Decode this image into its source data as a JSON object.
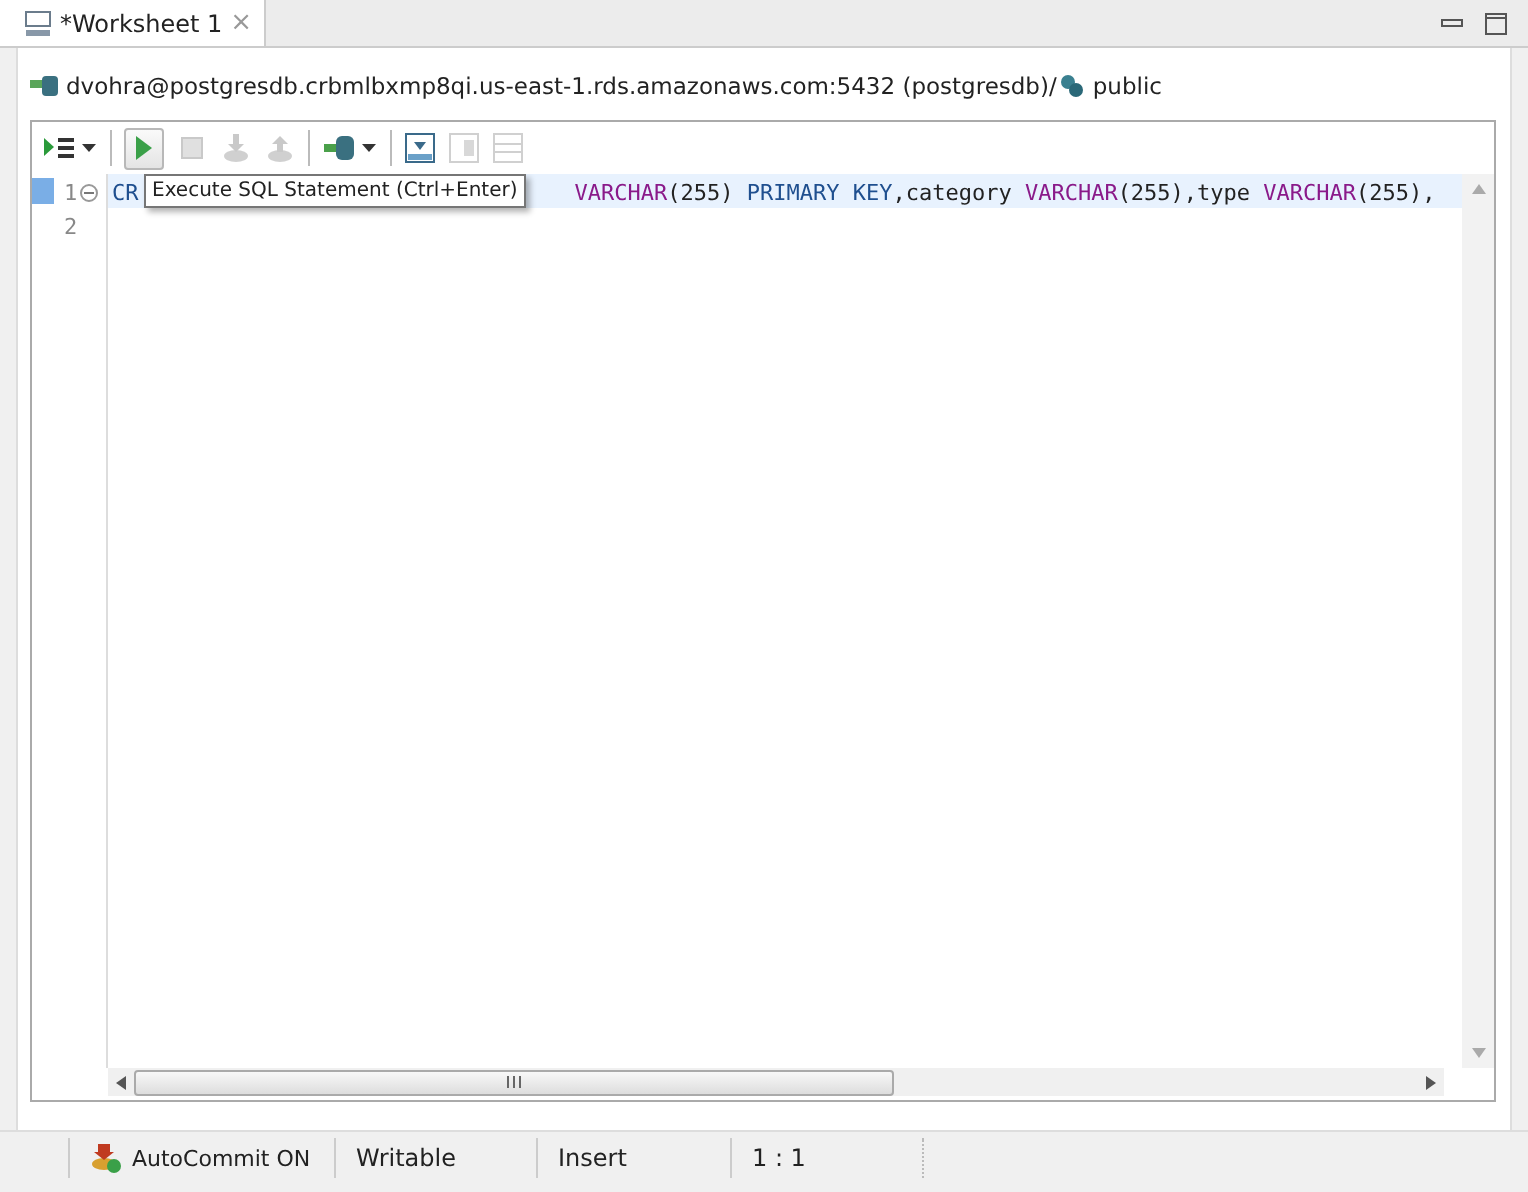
{
  "tab": {
    "label": "*Worksheet 1",
    "close": "×",
    "selected": true
  },
  "connection": {
    "text": "dvohra@postgresdb.crbmlbxmp8qi.us-east-1.rds.amazonaws.com:5432 (postgresdb)/",
    "schema": "public"
  },
  "toolbar": [
    {
      "kind": "run-script",
      "disabled": false
    },
    {
      "kind": "dropdown",
      "disabled": false
    },
    {
      "kind": "sep"
    },
    {
      "kind": "execute",
      "disabled": false
    },
    {
      "kind": "stop",
      "disabled": true
    },
    {
      "kind": "commit",
      "disabled": true
    },
    {
      "kind": "rollback",
      "disabled": true
    },
    {
      "kind": "sep"
    },
    {
      "kind": "connect",
      "disabled": false
    },
    {
      "kind": "dropdown",
      "disabled": false
    },
    {
      "kind": "sep"
    },
    {
      "kind": "export",
      "disabled": false
    },
    {
      "kind": "layout-columns",
      "disabled": true
    },
    {
      "kind": "layout-rows",
      "disabled": true
    }
  ],
  "tooltip": "Execute SQL Statement (Ctrl+Enter)",
  "editor": {
    "lines": [
      {
        "number": "1",
        "current": true,
        "tokens": [
          {
            "kind": "keyword",
            "text": "CR"
          },
          {
            "kind": "hidden"
          },
          {
            "kind": "type",
            "text": "VARCHAR"
          },
          {
            "kind": "plain",
            "text": "(255) "
          },
          {
            "kind": "keyword",
            "text": "PRIMARY KEY"
          },
          {
            "kind": "plain",
            "text": ",category "
          },
          {
            "kind": "type",
            "text": "VARCHAR"
          },
          {
            "kind": "plain",
            "text": "(255),type "
          },
          {
            "kind": "type",
            "text": "VARCHAR"
          },
          {
            "kind": "plain",
            "text": "(255),"
          }
        ]
      },
      {
        "number": "2",
        "current": false
      }
    ]
  },
  "status_bar": [
    {
      "kind": "autocommit",
      "text": "AutoCommit ON"
    },
    {
      "kind": "text",
      "text": "Writable"
    },
    {
      "kind": "text",
      "text": "Insert"
    },
    {
      "kind": "text",
      "text": "1 : 1"
    }
  ]
}
